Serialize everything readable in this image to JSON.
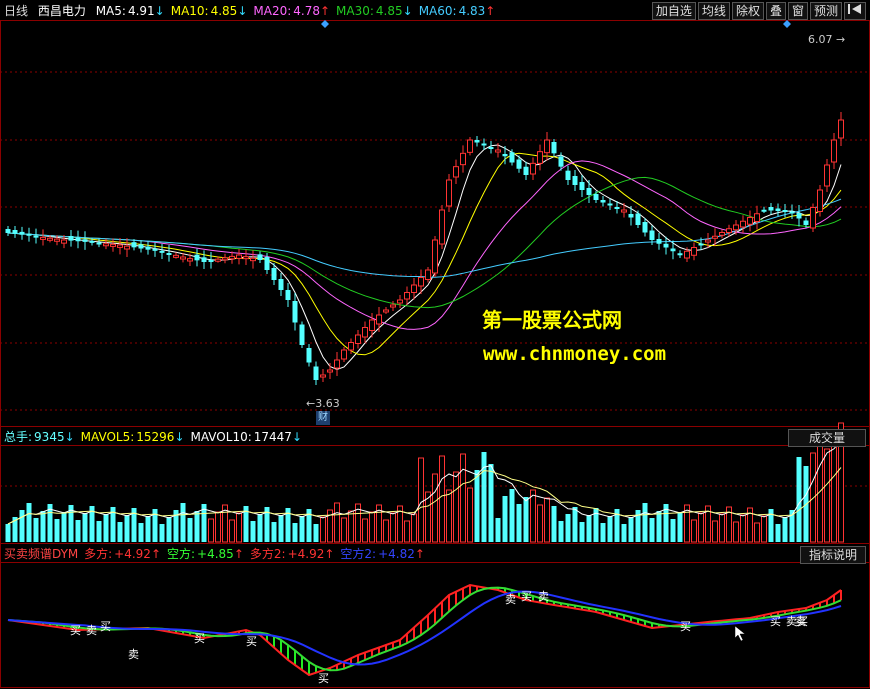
{
  "header": {
    "period": "日线",
    "stock_name": "西昌电力",
    "ma": [
      {
        "label": "MA5:",
        "value": "4.91",
        "arrow": "↓",
        "color": "#ffffff"
      },
      {
        "label": "MA10:",
        "value": "4.85",
        "arrow": "↓",
        "color": "#ffff00"
      },
      {
        "label": "MA20:",
        "value": "4.78",
        "arrow": "↑",
        "color": "#ff66ff"
      },
      {
        "label": "MA30:",
        "value": "4.85",
        "arrow": "↓",
        "color": "#22cc22"
      },
      {
        "label": "MA60:",
        "value": "4.83",
        "arrow": "↑",
        "color": "#44ccff"
      }
    ],
    "buttons": [
      "加自选",
      "均线",
      "除权",
      "叠",
      "窗",
      "预测"
    ],
    "nav_icon": "play-back-icon"
  },
  "price_chart": {
    "high_label": "6.07",
    "low_label": "3.63",
    "fin_badge": "财"
  },
  "volume_bar": {
    "items": [
      {
        "label": "总手:",
        "value": "9345",
        "arrow": "↓",
        "color": "#66ffff"
      },
      {
        "label": "MAVOL5:",
        "value": "15296",
        "arrow": "↓",
        "color": "#ffff00"
      },
      {
        "label": "MAVOL10:",
        "value": "17447",
        "arrow": "↓",
        "color": "#ffffff"
      }
    ],
    "pane_label": "成交量"
  },
  "indicator_bar": {
    "name": "买卖频谱DYM",
    "items": [
      {
        "label": "多方:",
        "value": "+4.92",
        "arrow": "↑",
        "color": "#ff3333"
      },
      {
        "label": "空方:",
        "value": "+4.85",
        "arrow": "↑",
        "color": "#33ff33"
      },
      {
        "label": "多方2:",
        "value": "+4.92",
        "arrow": "↑",
        "color": "#ff3333"
      },
      {
        "label": "空方2:",
        "value": "+4.82",
        "arrow": "↑",
        "color": "#3344ff"
      }
    ],
    "pane_label": "指标说明",
    "signals": [
      "买",
      "卖",
      "买",
      "卖",
      "买",
      "买",
      "买",
      "卖",
      "买",
      "卖",
      "买",
      "买",
      "卖",
      "卖",
      "买"
    ]
  },
  "watermark": {
    "line1": "第一股票公式网",
    "line2": "www.chnmoney.com"
  },
  "colors": {
    "up": "#ff3333",
    "down": "#54ffff",
    "grid": "#8b0000",
    "watermark": "#ffff00"
  }
}
